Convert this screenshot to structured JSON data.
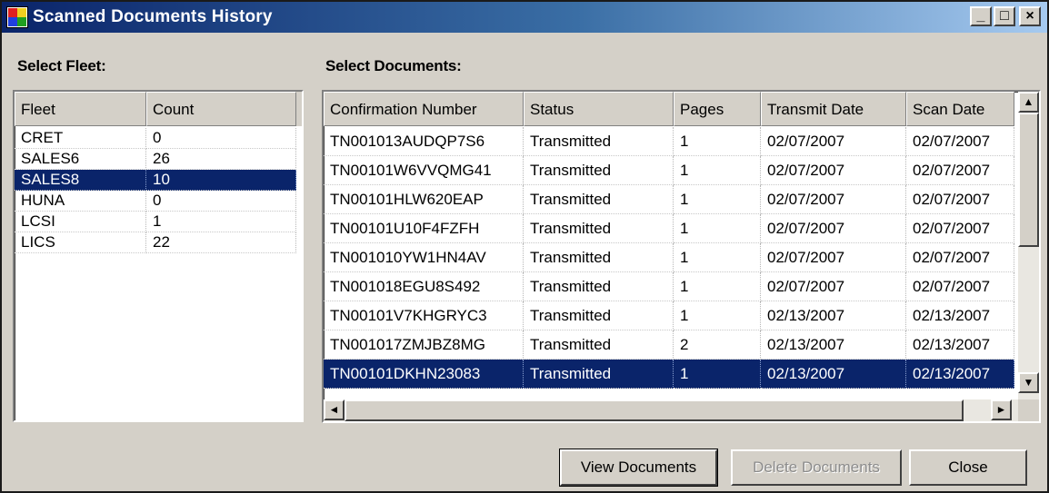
{
  "window": {
    "title": "Scanned Documents History",
    "controls": {
      "minimize": "_",
      "maximize": "□",
      "close": "×"
    }
  },
  "fleet_panel": {
    "label": "Select Fleet:",
    "columns": [
      "Fleet",
      "Count"
    ],
    "rows": [
      {
        "fleet": "CRET",
        "count": "0",
        "selected": false
      },
      {
        "fleet": "SALES6",
        "count": "26",
        "selected": false
      },
      {
        "fleet": "SALES8",
        "count": "10",
        "selected": true
      },
      {
        "fleet": "HUNA",
        "count": "0",
        "selected": false
      },
      {
        "fleet": "LCSI",
        "count": "1",
        "selected": false
      },
      {
        "fleet": "LICS",
        "count": "22",
        "selected": false
      }
    ]
  },
  "documents_panel": {
    "label": "Select Documents:",
    "columns": [
      "Confirmation Number",
      "Status",
      "Pages",
      "Transmit Date",
      "Scan Date"
    ],
    "rows": [
      {
        "confirmation": "TN001013AUDQP7S6",
        "status": "Transmitted",
        "pages": "1",
        "transmit_date": "02/07/2007",
        "scan_date": "02/07/2007",
        "selected": false
      },
      {
        "confirmation": "TN00101W6VVQMG41",
        "status": "Transmitted",
        "pages": "1",
        "transmit_date": "02/07/2007",
        "scan_date": "02/07/2007",
        "selected": false
      },
      {
        "confirmation": "TN00101HLW620EAP",
        "status": "Transmitted",
        "pages": "1",
        "transmit_date": "02/07/2007",
        "scan_date": "02/07/2007",
        "selected": false
      },
      {
        "confirmation": "TN00101U10F4FZFH",
        "status": "Transmitted",
        "pages": "1",
        "transmit_date": "02/07/2007",
        "scan_date": "02/07/2007",
        "selected": false
      },
      {
        "confirmation": "TN001010YW1HN4AV",
        "status": "Transmitted",
        "pages": "1",
        "transmit_date": "02/07/2007",
        "scan_date": "02/07/2007",
        "selected": false
      },
      {
        "confirmation": "TN001018EGU8S492",
        "status": "Transmitted",
        "pages": "1",
        "transmit_date": "02/07/2007",
        "scan_date": "02/07/2007",
        "selected": false
      },
      {
        "confirmation": "TN00101V7KHGRYC3",
        "status": "Transmitted",
        "pages": "1",
        "transmit_date": "02/13/2007",
        "scan_date": "02/13/2007",
        "selected": false
      },
      {
        "confirmation": "TN001017ZMJBZ8MG",
        "status": "Transmitted",
        "pages": "2",
        "transmit_date": "02/13/2007",
        "scan_date": "02/13/2007",
        "selected": false
      },
      {
        "confirmation": "TN00101DKHN23083",
        "status": "Transmitted",
        "pages": "1",
        "transmit_date": "02/13/2007",
        "scan_date": "02/13/2007",
        "selected": true
      }
    ]
  },
  "scrollbar_glyphs": {
    "up": "▲",
    "down": "▼",
    "left": "◄",
    "right": "►"
  },
  "buttons": {
    "view": "View Documents",
    "delete": "Delete Documents",
    "close": "Close"
  }
}
